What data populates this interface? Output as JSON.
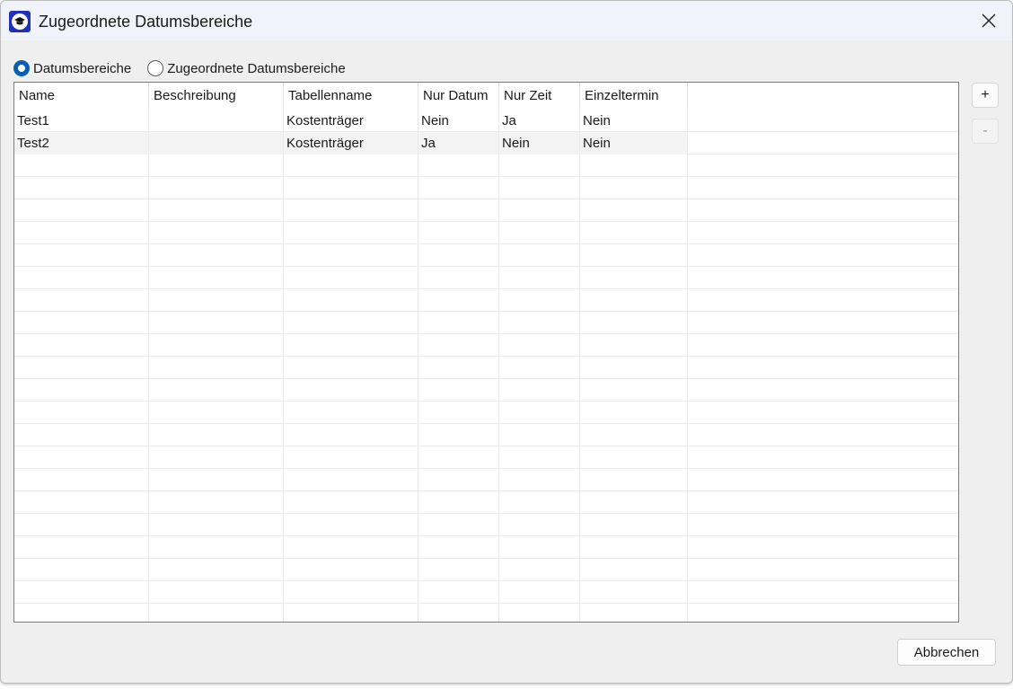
{
  "window": {
    "title": "Zugeordnete Datumsbereiche",
    "icon": "app-logo-icon",
    "close_icon": "close-icon"
  },
  "radios": {
    "options": [
      {
        "label": "Datumsbereiche",
        "selected": true
      },
      {
        "label": "Zugeordnete Datumsbereiche",
        "selected": false
      }
    ]
  },
  "table": {
    "columns": [
      "Name",
      "Beschreibung",
      "Tabellenname",
      "Nur Datum",
      "Nur Zeit",
      "Einzeltermin"
    ],
    "rows": [
      [
        "Test1",
        "",
        "Kostenträger",
        "Nein",
        "Ja",
        "Nein"
      ],
      [
        "Test2",
        "",
        "Kostenträger",
        "Ja",
        "Nein",
        "Nein"
      ]
    ]
  },
  "side_buttons": {
    "add_label": "+",
    "remove_label": "-"
  },
  "footer": {
    "cancel_label": "Abbrechen"
  },
  "colors": {
    "accent": "#0a5fb4",
    "app_icon": "#1f2fbf"
  }
}
